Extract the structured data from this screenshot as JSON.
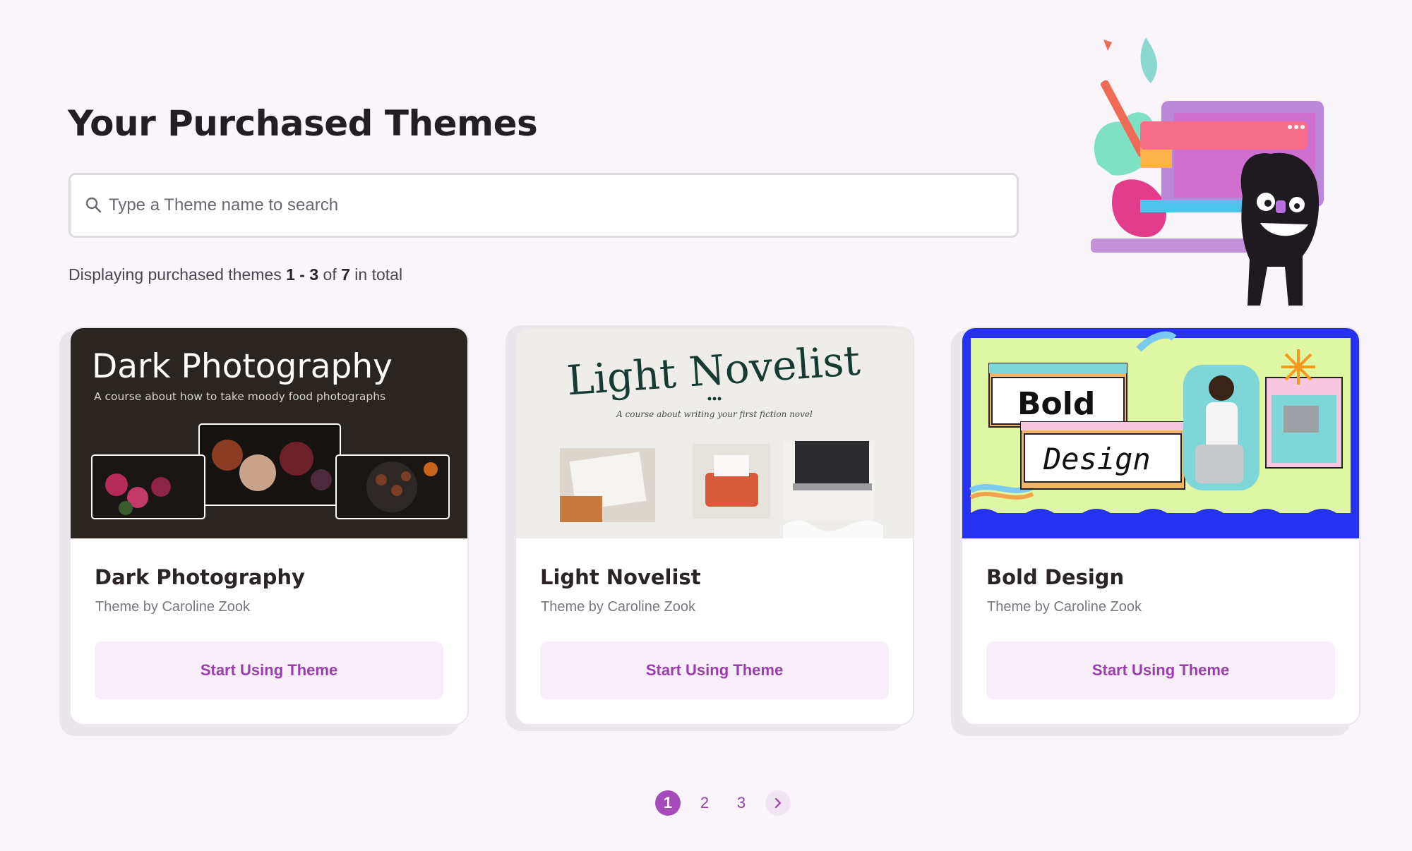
{
  "header": {
    "title": "Your Purchased Themes"
  },
  "search": {
    "placeholder": "Type a Theme name to search",
    "value": ""
  },
  "summary": {
    "prefix": "Displaying purchased themes",
    "range": "1 - 3",
    "of_word": "of",
    "total": "7",
    "suffix": "in total"
  },
  "themes": [
    {
      "thumb_title": "Dark Photography",
      "thumb_subtitle": "A course about how to take moody food photographs",
      "name": "Dark Photography",
      "author": "Theme by Caroline Zook",
      "button_label": "Start Using Theme"
    },
    {
      "thumb_title": "Light Novelist",
      "thumb_subtitle": "A course about writing your first fiction novel",
      "name": "Light Novelist",
      "author": "Theme by Caroline Zook",
      "button_label": "Start Using Theme"
    },
    {
      "thumb_title_line1": "Bold",
      "thumb_title_line2": "Design",
      "name": "Bold Design",
      "author": "Theme by Caroline Zook",
      "button_label": "Start Using Theme"
    }
  ],
  "pagination": {
    "pages": [
      "1",
      "2",
      "3"
    ],
    "current": "1",
    "next_icon": "chevron-right-icon"
  },
  "colors": {
    "accent": "#a64bbb",
    "button_bg": "#f8eef9",
    "background": "#f9f5fa",
    "bold_design_blue": "#2631f2",
    "bold_design_lime": "#dff7a2"
  }
}
